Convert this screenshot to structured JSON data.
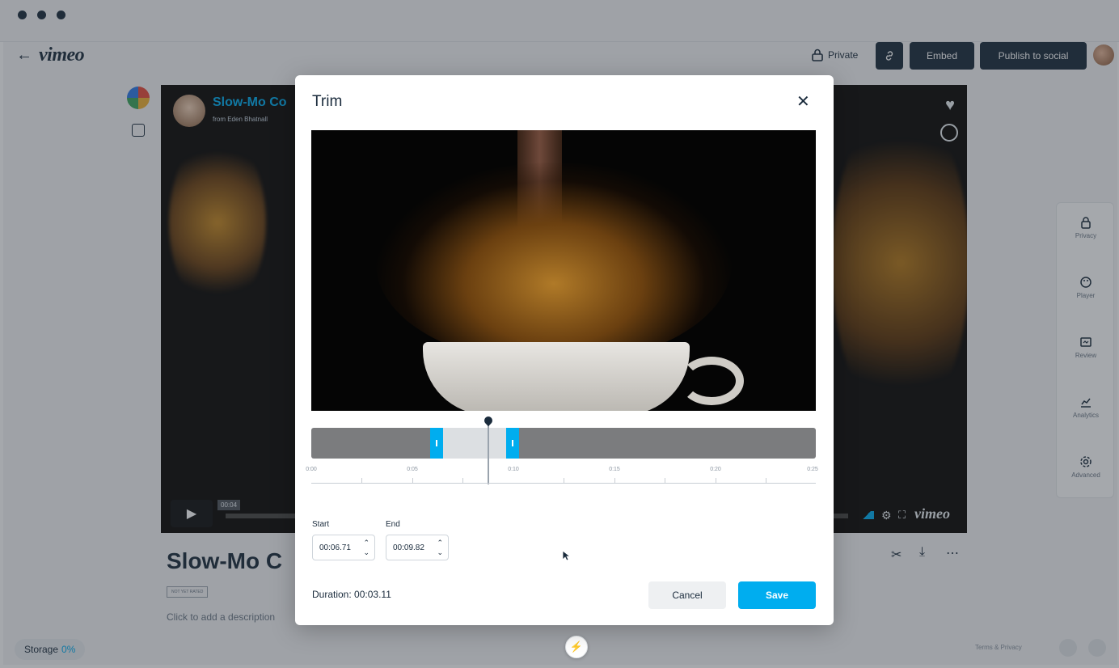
{
  "header": {
    "logo": "vimeo",
    "privacy_label": "Private",
    "embed_label": "Embed",
    "publish_label": "Publish to social"
  },
  "player": {
    "video_title": "Slow-Mo Co",
    "byline": "from Eden Bhatnall",
    "timestamp": "00:04",
    "watermark": "vimeo"
  },
  "video": {
    "title": "Slow-Mo C",
    "badge": "NOT YET RATED",
    "description_placeholder": "Click to add a description"
  },
  "footer": {
    "storage_label": "Storage",
    "storage_value": "0%",
    "terms": "Terms & Privacy"
  },
  "sidebar": {
    "items": [
      {
        "label": "Privacy",
        "icon": "lock-icon"
      },
      {
        "label": "Player",
        "icon": "palette-icon"
      },
      {
        "label": "Review",
        "icon": "review-icon"
      },
      {
        "label": "Analytics",
        "icon": "analytics-icon"
      },
      {
        "label": "Advanced",
        "icon": "gear-icon"
      }
    ]
  },
  "modal": {
    "title": "Trim",
    "ruler_ticks": [
      "0:00",
      "0:05",
      "0:10",
      "0:15",
      "0:20",
      "0:25"
    ],
    "start_label": "Start",
    "start_value": "00:06.71",
    "end_label": "End",
    "end_value": "00:09.82",
    "duration_label": "Duration:",
    "duration_value": "00:03.11",
    "cancel_label": "Cancel",
    "save_label": "Save"
  },
  "colors": {
    "accent": "#00adef",
    "dark": "#1a2b3c",
    "track": "#7b7c7e"
  }
}
